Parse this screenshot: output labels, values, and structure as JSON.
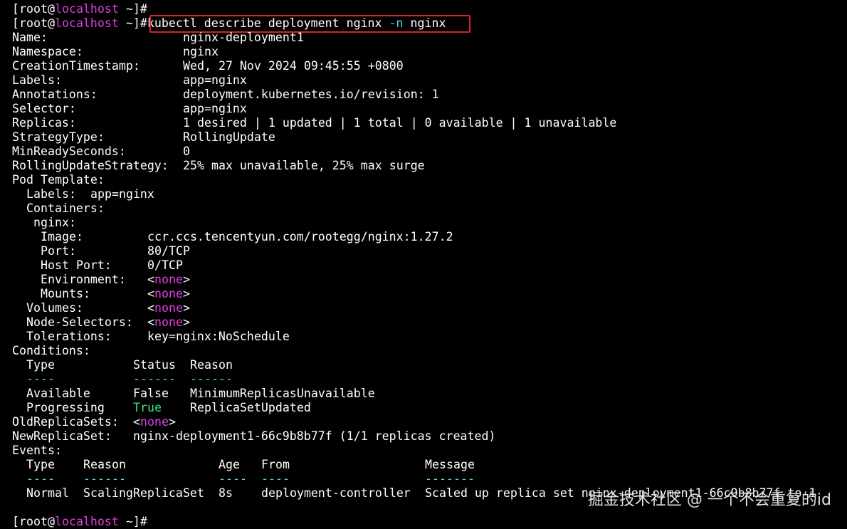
{
  "prompt": {
    "open": "[",
    "user": "root",
    "at": "@",
    "host": "localhost",
    "close": " ~]#"
  },
  "command": {
    "base": "kubectl describe deployment nginx ",
    "flag": "-n",
    "rest": " nginx"
  },
  "describe": [
    {
      "key": "Name:",
      "val": "nginx-deployment1"
    },
    {
      "key": "Namespace:",
      "val": "nginx"
    },
    {
      "key": "CreationTimestamp:",
      "val": "Wed, 27 Nov 2024 09:45:55 +0800"
    },
    {
      "key": "Labels:",
      "val": "app=nginx"
    },
    {
      "key": "Annotations:",
      "val": "deployment.kubernetes.io/revision: 1"
    },
    {
      "key": "Selector:",
      "val": "app=nginx"
    },
    {
      "key": "Replicas:",
      "val": "1 desired | 1 updated | 1 total | 0 available | 1 unavailable"
    },
    {
      "key": "StrategyType:",
      "val": "RollingUpdate"
    },
    {
      "key": "MinReadySeconds:",
      "val": "0"
    },
    {
      "key": "RollingUpdateStrategy:",
      "val": "25% max unavailable, 25% max surge"
    }
  ],
  "pod_template": {
    "heading": "Pod Template:",
    "labels_key": "Labels:",
    "labels_val": "app=nginx",
    "containers_key": "Containers:",
    "container_name": "nginx:",
    "image_key": "Image:",
    "image_val": "ccr.ccs.tencentyun.com/rootegg/nginx:1.27.2",
    "port_key": "Port:",
    "port_val": "80/TCP",
    "host_port_key": "Host Port:",
    "host_port_val": "0/TCP",
    "environment_key": "Environment:",
    "mounts_key": "Mounts:",
    "volumes_key": "Volumes:",
    "node_selectors_key": "Node-Selectors:",
    "tolerations_key": "Tolerations:",
    "tolerations_val": "key=nginx:NoSchedule",
    "none": "none"
  },
  "conditions": {
    "heading": "Conditions:",
    "headers": [
      "Type",
      "Status",
      "Reason"
    ],
    "dividers": [
      "----",
      "------",
      "------"
    ],
    "rows": [
      {
        "type": "Available",
        "status": "False",
        "reason": "MinimumReplicasUnavailable"
      },
      {
        "type": "Progressing",
        "status": "True",
        "reason": "ReplicaSetUpdated"
      }
    ]
  },
  "replica_sets": {
    "old_key": "OldReplicaSets:",
    "new_key": "NewReplicaSet:",
    "new_val": "nginx-deployment1-66c9b8b77f (1/1 replicas created)"
  },
  "events": {
    "heading": "Events:",
    "headers": [
      "Type",
      "Reason",
      "Age",
      "From",
      "Message"
    ],
    "dividers": [
      "----",
      "------",
      "----",
      "----",
      "-------"
    ],
    "rows": [
      {
        "type": "Normal",
        "reason": "ScalingReplicaSet",
        "age": "8s",
        "from": "deployment-controller",
        "message": "Scaled up replica set nginx-deployment1-66c9b8b77f to 1"
      }
    ]
  },
  "watermark": "掘金技术社区 @ 一个不会重复的id",
  "colors": {
    "background": "#000000",
    "text": "#ffffff",
    "hostname": "#e040e0",
    "none_value": "#e040e0",
    "true_value": "#2ee87a",
    "flag": "#56d4ea",
    "highlight_border": "#d9222a"
  }
}
